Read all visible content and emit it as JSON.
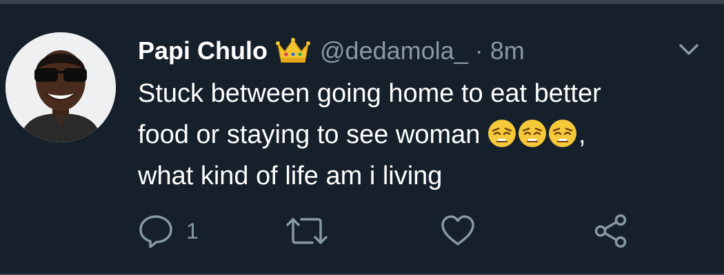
{
  "tweet": {
    "author_name": "Papi Chulo",
    "handle": "@dedamola_",
    "separator": "·",
    "time": "8m",
    "text_line1": "Stuck between going home to eat better",
    "text_line2_prefix": "food or staying to see woman ",
    "text_line2_suffix": ",",
    "text_line3": "what kind of life am i living",
    "emojis": [
      "weary-face",
      "weary-face",
      "weary-face"
    ],
    "badge_icon": "crown-emoji"
  },
  "actions": {
    "reply_count": "1",
    "icons": [
      "reply-icon",
      "retweet-icon",
      "like-icon",
      "share-icon"
    ]
  },
  "colors": {
    "background": "#15202b",
    "secondary_text": "#8899a6",
    "primary_text": "#ffffff",
    "border": "#38444d"
  }
}
